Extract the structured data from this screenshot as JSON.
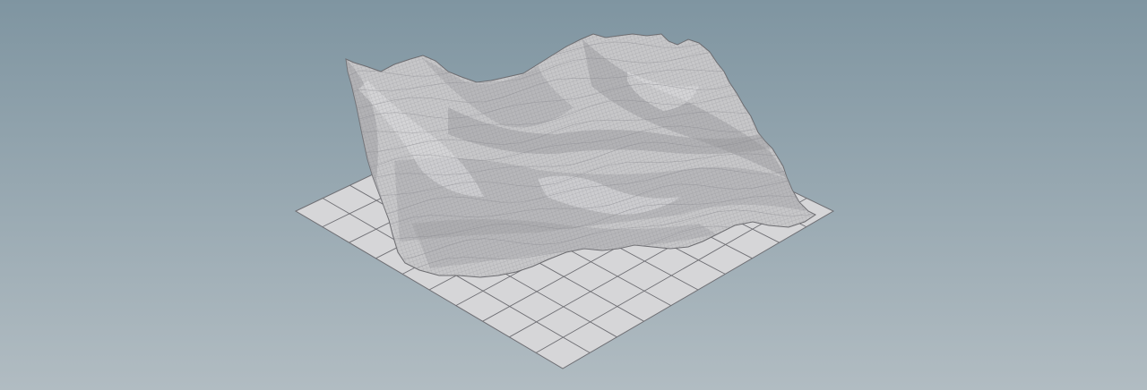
{
  "viewport": {
    "background_top": "#7f95a1",
    "background_bottom": "#b1bcc2"
  },
  "ground_grid": {
    "fill": "#d6d6d8",
    "line_color": "#6f6f74",
    "divisions": 10
  },
  "terrain_mesh": {
    "surface_color": "#c7c7c9",
    "shade_color": "#9a9a9e",
    "wire_color": "#7e7e83"
  }
}
